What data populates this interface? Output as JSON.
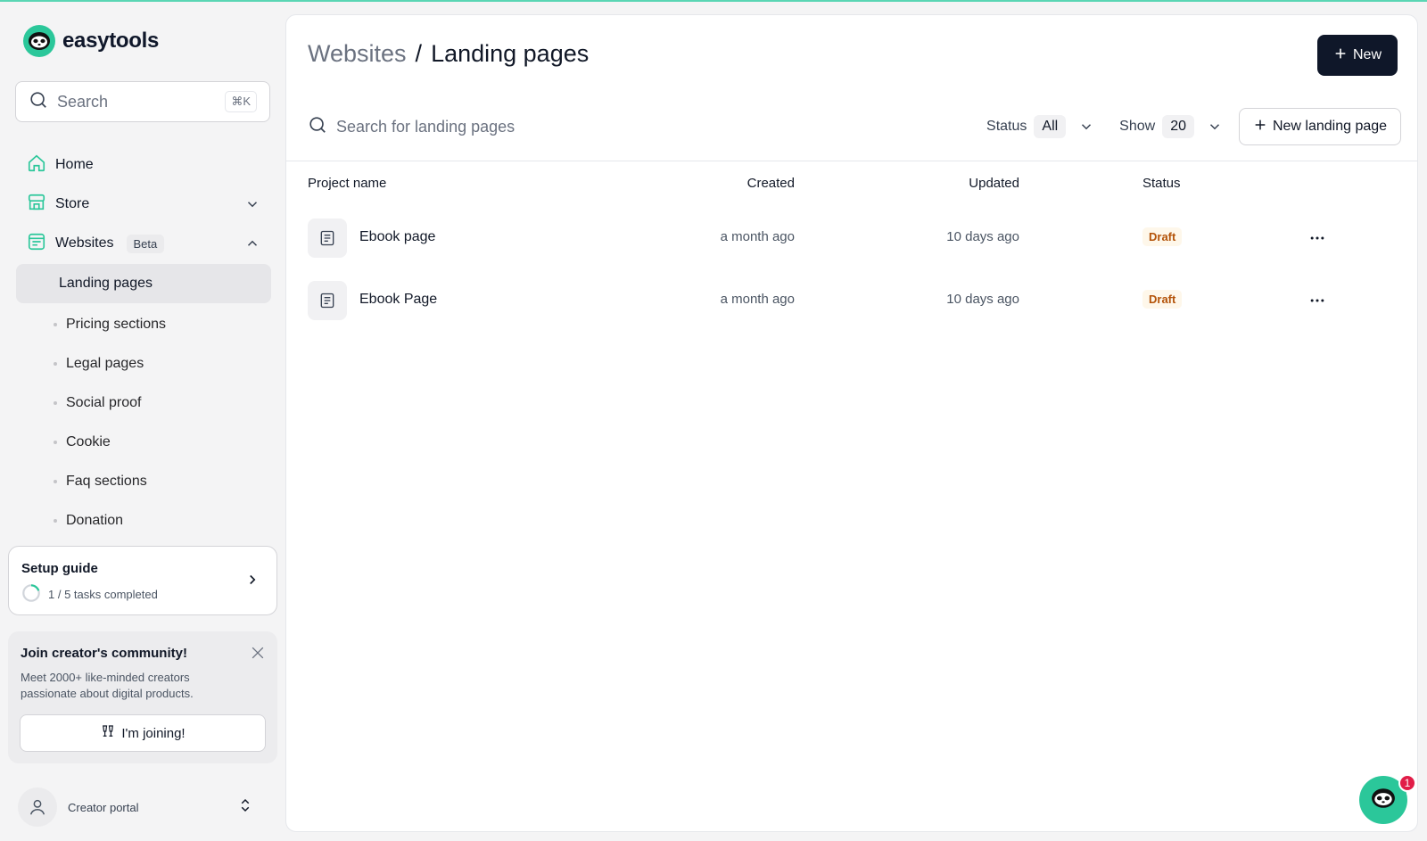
{
  "brand": {
    "name": "easytools",
    "accent": "#2bc79a"
  },
  "sidebar": {
    "search": {
      "placeholder": "Search",
      "shortcut": "⌘K"
    },
    "nav": [
      {
        "label": "Home",
        "icon": "home-icon"
      },
      {
        "label": "Store",
        "icon": "store-icon",
        "expanded": false
      },
      {
        "label": "Websites",
        "icon": "websites-icon",
        "badge": "Beta",
        "expanded": true
      }
    ],
    "sub_items": [
      {
        "label": "Landing pages",
        "active": true
      },
      {
        "label": "Pricing sections"
      },
      {
        "label": "Legal pages"
      },
      {
        "label": "Social proof"
      },
      {
        "label": "Cookie"
      },
      {
        "label": "Faq sections"
      },
      {
        "label": "Donation"
      }
    ],
    "setup": {
      "title": "Setup guide",
      "progress": "1 / 5 tasks completed",
      "completed": 1,
      "total": 5
    },
    "community": {
      "title": "Join creator's community!",
      "description": "Meet 2000+ like-minded creators passionate about digital products.",
      "button": "I'm joining!"
    },
    "portal": {
      "label": "Creator portal"
    }
  },
  "main": {
    "breadcrumb": {
      "parent": "Websites",
      "separator": "/",
      "current": "Landing pages"
    },
    "new_button": "New",
    "search_placeholder": "Search for landing pages",
    "filters": {
      "status": {
        "label": "Status",
        "value": "All"
      },
      "show": {
        "label": "Show",
        "value": "20"
      }
    },
    "new_landing_button": "New landing page",
    "table": {
      "headers": [
        "Project name",
        "Created",
        "Updated",
        "Status"
      ],
      "rows": [
        {
          "name": "Ebook page",
          "created": "a month ago",
          "updated": "10 days ago",
          "status": "Draft"
        },
        {
          "name": "Ebook Page",
          "created": "a month ago",
          "updated": "10 days ago",
          "status": "Draft"
        }
      ]
    }
  },
  "chat": {
    "unread": "1"
  }
}
